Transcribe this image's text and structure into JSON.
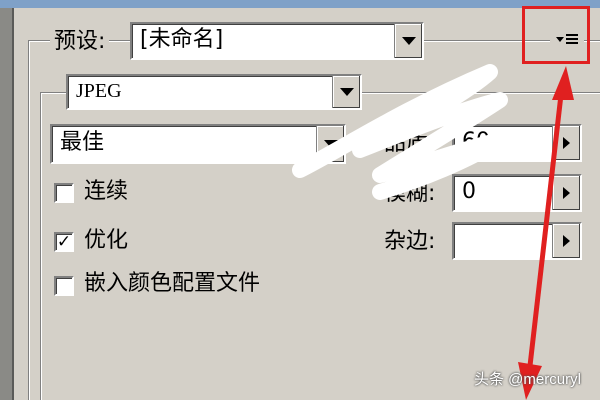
{
  "preset": {
    "label": "预设:",
    "value": "[未命名]"
  },
  "format": {
    "value": "JPEG"
  },
  "quality_preset": {
    "value": "最佳"
  },
  "options": {
    "progressive": {
      "label": "连续",
      "checked": false
    },
    "optimized": {
      "label": "优化",
      "checked": true
    },
    "embed_profile": {
      "label": "嵌入颜色配置文件",
      "checked": false
    }
  },
  "right_fields": {
    "quality": {
      "label": "品质:",
      "value": "60"
    },
    "blur": {
      "label": "模糊:",
      "value": "0"
    },
    "matte": {
      "label": "杂边:",
      "value": ""
    }
  },
  "icons": {
    "panel_menu": "panel-menu-icon",
    "dropdown": "chevron-down-icon",
    "slider": "triangle-right-icon",
    "check": "check-icon"
  },
  "colors": {
    "background": "#d4d0c8",
    "annotation": "#e02020",
    "title_strip": "#7fa1c8"
  },
  "watermark": "头条 @mercuryl"
}
